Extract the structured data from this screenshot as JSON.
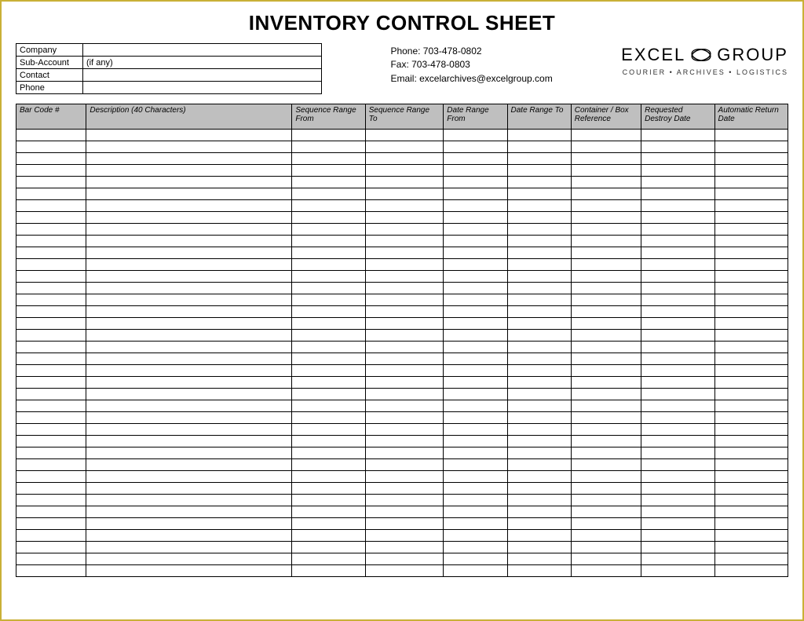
{
  "title": "INVENTORY CONTROL SHEET",
  "infoBox": {
    "rows": [
      {
        "label": "Company",
        "value": ""
      },
      {
        "label": "Sub-Account",
        "value": "(if any)"
      },
      {
        "label": "Contact",
        "value": ""
      },
      {
        "label": "Phone",
        "value": ""
      }
    ]
  },
  "contact": {
    "phone": "Phone: 703-478-0802",
    "fax": "Fax:  703-478-0803",
    "email": "Email: excelarchives@excelgroup.com"
  },
  "logo": {
    "word1": "EXCEL",
    "word2": "GROUP",
    "tagline": "COURIER • ARCHIVES • LOGISTICS"
  },
  "columns": [
    "Bar Code #",
    "Description (40 Characters)",
    "Sequence Range From",
    "Sequence Range To",
    "Date Range From",
    "Date Range To",
    "Container / Box Reference",
    "Requested Destroy Date",
    "Automatic Return Date"
  ],
  "rowCount": 38
}
